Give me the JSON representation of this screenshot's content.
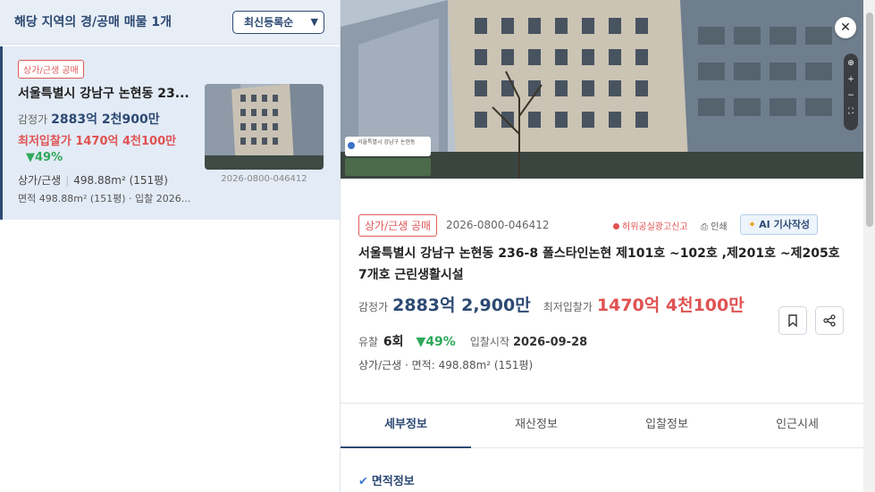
{
  "list": {
    "title": "해당 지역의 경/공매 매물 1개",
    "sort": {
      "selected": "최신등록순",
      "icon": "chevron-down-icon"
    },
    "card": {
      "badge": "상가/근생 공매",
      "address": "서울특별시 강남구 논현동 23...",
      "appraisal_label": "감정가",
      "appraisal_value": "2883억 2천900만",
      "min_bid": "최저입찰가 1470억 4천100만",
      "rate": "▼49%",
      "type": "상가/근생",
      "area": "498.88m² (151평)",
      "area_line": "면적 498.88m² (151평) · 입찰 2026...",
      "case_no": "2026-0800-046412"
    }
  },
  "detail": {
    "close_icon": "close-icon",
    "photo_tag": "서울특별시 강남구 논현동",
    "badge": "상가/근생 공매",
    "case_no": "2026-0800-046412",
    "report_label": "허위공실광고신고",
    "print_label": "인쇄",
    "ai_label": "AI 기사작성",
    "address": "서울특별시 강남구 논현동 236-8 폴스타인논현 제101호 ~102호 ,제201호 ~제205호 7개호 근린생활시설",
    "appraisal_label": "감정가",
    "appraisal_value": "2883억 2,900만",
    "min_bid_label": "최저입찰가",
    "min_bid_value": "1470억 4천100만",
    "fail_label": "유찰",
    "fail_count": "6회",
    "rate": "▼49%",
    "start_label": "입찰시작",
    "start_date": "2026-09-28",
    "spec": "상가/근생 · 면적: 498.88m² (151평)",
    "tabs": [
      "세부정보",
      "재산정보",
      "입찰정보",
      "인근시세"
    ],
    "section_title": "면적정보"
  },
  "colors": {
    "brand": "#2d4a73",
    "accent_red": "#e05252",
    "accent_green": "#2fa85a"
  }
}
